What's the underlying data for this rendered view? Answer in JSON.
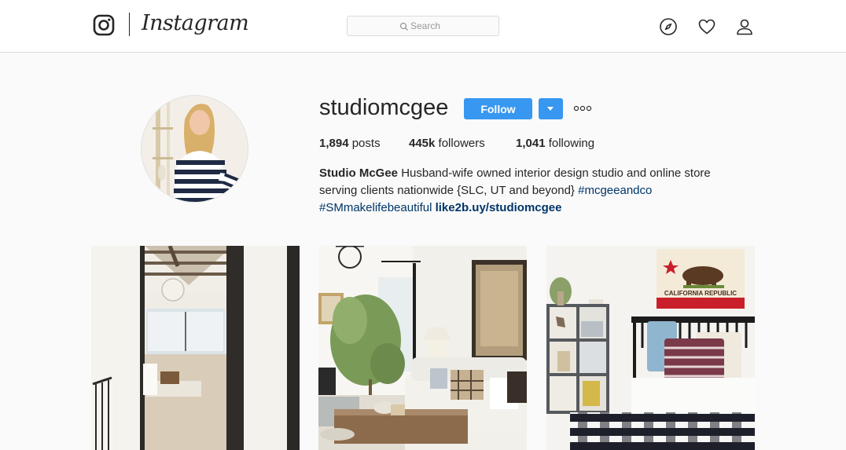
{
  "nav": {
    "brand": "Instagram",
    "search_placeholder": "Search",
    "icons": [
      "instagram-logo-icon",
      "search-icon",
      "compass-icon",
      "heart-icon",
      "user-icon"
    ]
  },
  "profile": {
    "username": "studiomcgee",
    "follow_label": "Follow",
    "posts_count": "1,894",
    "posts_label": "posts",
    "followers_count": "445k",
    "followers_label": "followers",
    "following_count": "1,041",
    "following_label": "following",
    "display_name": "Studio McGee",
    "bio_line1": "Husband-wife owned interior design studio and online store",
    "bio_line2": "serving clients nationwide {SLC, UT and beyond}",
    "hashtag1": "#mcgeeandco",
    "hashtag2": "#SMmakelifebeautiful",
    "link": "like2b.uy/studiomcgee"
  },
  "posts": [
    {
      "name": "post-hallway-bedroom"
    },
    {
      "name": "post-living-room"
    },
    {
      "name": "post-kids-bedroom",
      "flag_text": "CALIFORNIA REPUBLIC"
    }
  ],
  "colors": {
    "accent": "#3897f0",
    "link": "#003569",
    "border": "#dbdbdb",
    "background": "#fafafa"
  }
}
